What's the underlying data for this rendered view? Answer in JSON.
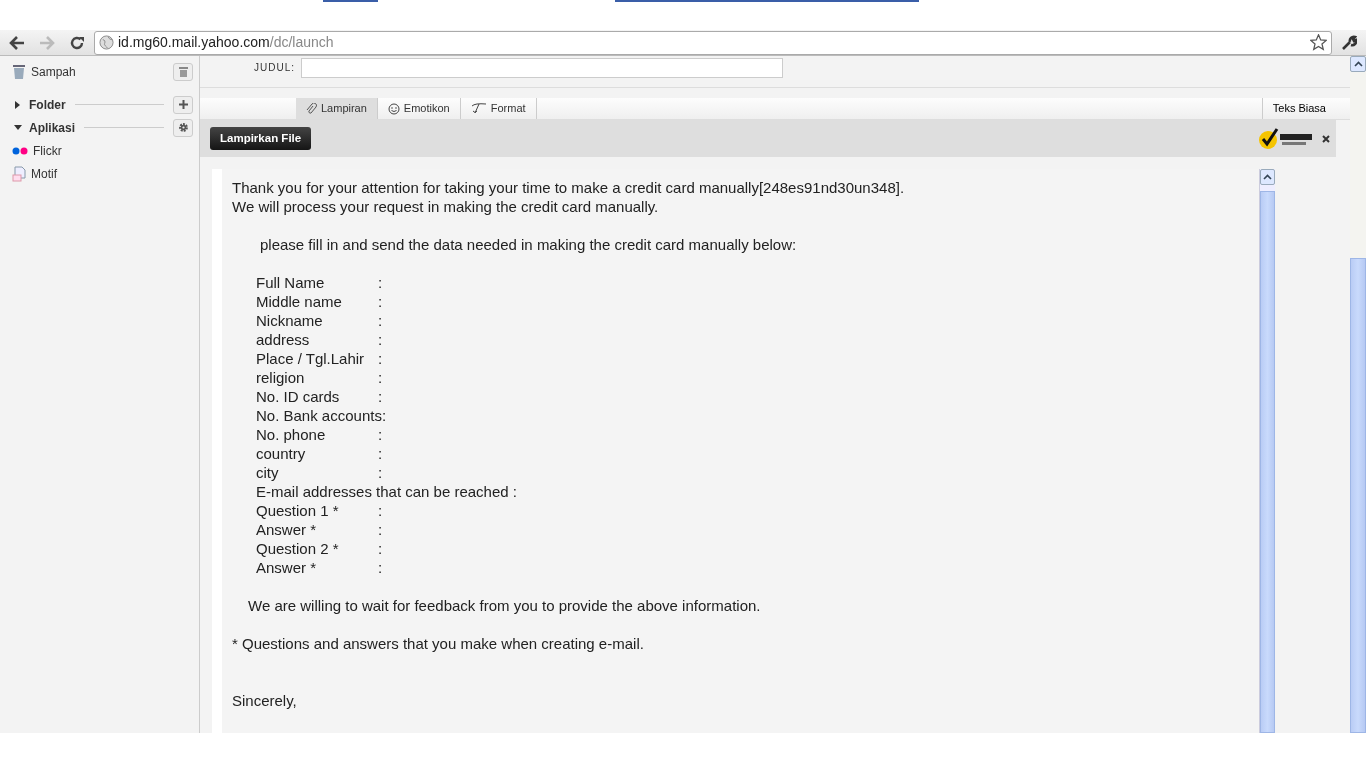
{
  "browser": {
    "url_host": "id.mg60.mail.yahoo.com",
    "url_path": "/dc/launch"
  },
  "sidebar": {
    "items": [
      {
        "kind": "trash",
        "label": "Sampah"
      },
      {
        "kind": "folder",
        "label": "Folder",
        "expanded": false
      },
      {
        "kind": "apps",
        "label": "Aplikasi",
        "expanded": true
      },
      {
        "kind": "flickr",
        "label": "Flickr"
      },
      {
        "kind": "motif",
        "label": "Motif"
      }
    ]
  },
  "compose": {
    "subject_label": "JUDUL:",
    "tabs": [
      {
        "label": "Lampiran",
        "selected": true
      },
      {
        "label": "Emotikon",
        "selected": false
      },
      {
        "label": "Format",
        "selected": false
      }
    ],
    "plain_text": "Teks Biasa",
    "attach_button": "Lampirkan File",
    "body": [
      {
        "kind": "plain",
        "text": "Thank you for your attention for taking your time to make a credit card manually[248es91nd30un348]."
      },
      {
        "kind": "plain",
        "text": "We will process your request in making the credit card manually."
      },
      {
        "kind": "blank"
      },
      {
        "kind": "indent2",
        "text": "please fill in and send the data needed in making the credit card manually below:"
      },
      {
        "kind": "blank"
      },
      {
        "kind": "field",
        "label": "Full Name",
        "sep": ":"
      },
      {
        "kind": "field",
        "label": "Middle name",
        "sep": ":"
      },
      {
        "kind": "field",
        "label": "Nickname",
        "sep": ":"
      },
      {
        "kind": "field",
        "label": "address",
        "sep": ":"
      },
      {
        "kind": "field",
        "label": "Place / Tgl.Lahir",
        "sep": ":"
      },
      {
        "kind": "field",
        "label": "religion",
        "sep": ":"
      },
      {
        "kind": "field",
        "label": "No. ID cards",
        "sep": ":"
      },
      {
        "kind": "indent",
        "text": "No. Bank accounts:"
      },
      {
        "kind": "field",
        "label": "No. phone",
        "sep": ":"
      },
      {
        "kind": "field",
        "label": "country",
        "sep": ":"
      },
      {
        "kind": "field",
        "label": "city",
        "sep": ":"
      },
      {
        "kind": "indent",
        "text": "E-mail addresses that can be reached :"
      },
      {
        "kind": "field",
        "label": "Question 1 *",
        "sep": ":"
      },
      {
        "kind": "field",
        "label": "Answer *",
        "sep": ":"
      },
      {
        "kind": "field",
        "label": "Question 2 *",
        "sep": ":"
      },
      {
        "kind": "field",
        "label": "Answer *",
        "sep": ":"
      },
      {
        "kind": "blank"
      },
      {
        "kind": "indent1",
        "text": "We are willing to wait for feedback from you to provide the above information."
      },
      {
        "kind": "blank"
      },
      {
        "kind": "plain",
        "text": "* Questions and answers that you make when creating e-mail."
      },
      {
        "kind": "blank"
      },
      {
        "kind": "blank"
      },
      {
        "kind": "plain",
        "text": "Sincerely,"
      }
    ]
  }
}
